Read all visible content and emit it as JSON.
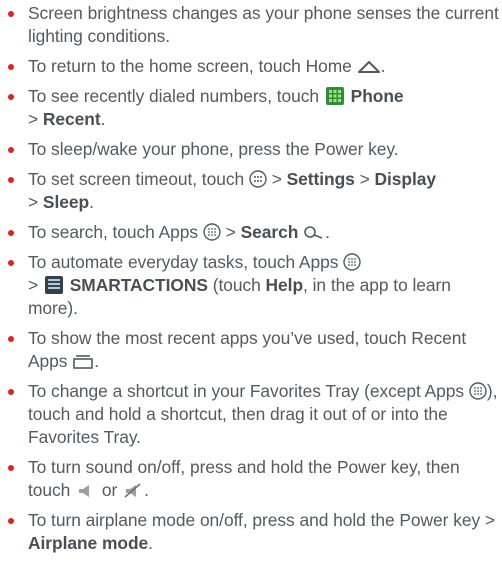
{
  "tips": [
    {
      "text": "Screen brightness changes as your phone senses the current lighting conditions."
    },
    {
      "text": "To return to the home screen, touch Home",
      "icon": "home-icon"
    },
    {
      "a": "To see recently dialed numbers, touch",
      "icon": "phone-app-icon",
      "b": "Phone",
      "c": ">",
      "d": "Recent",
      "e": "."
    },
    {
      "text": "To sleep/wake your phone, press the Power key."
    },
    {
      "a": "To set screen timeout, touch",
      "icon": "menu-icon",
      "b": ">",
      "c": "Settings",
      "d": ">",
      "e": "Display",
      "f": ">",
      "g": "Sleep",
      "h": "."
    },
    {
      "a": "To search, touch Apps",
      "icon": "apps-icon",
      "b": ">",
      "c": "Search",
      "icon2": "search-icon"
    },
    {
      "a": "To automate everyday tasks, touch Apps",
      "icon": "apps-icon",
      "b": ">",
      "icon2": "smartactions-app-icon",
      "c": "SMARTACTIONS",
      "d": "(touch",
      "e": "Help",
      "f": ", in the app to learn more)."
    },
    {
      "a": "To show the most recent apps you’ve used, touch Recent Apps",
      "icon": "recent-apps-icon"
    },
    {
      "a": "To change a shortcut in your Favorites Tray (except Apps",
      "icon": "apps-icon",
      "b": "), touch and hold a shortcut, then drag it out of or into the Favorites Tray."
    },
    {
      "a": "To turn sound on/off, press and hold the Power key, then touch",
      "icon": "volume-on-icon",
      "b": "or",
      "icon2": "volume-off-icon",
      "c": "."
    },
    {
      "a": "To turn airplane mode on/off, press and hold the Power key >",
      "b": "Airplane mode",
      "c": "."
    }
  ],
  "colors": {
    "bullet": "#e2231a",
    "text": "#555a5f"
  }
}
